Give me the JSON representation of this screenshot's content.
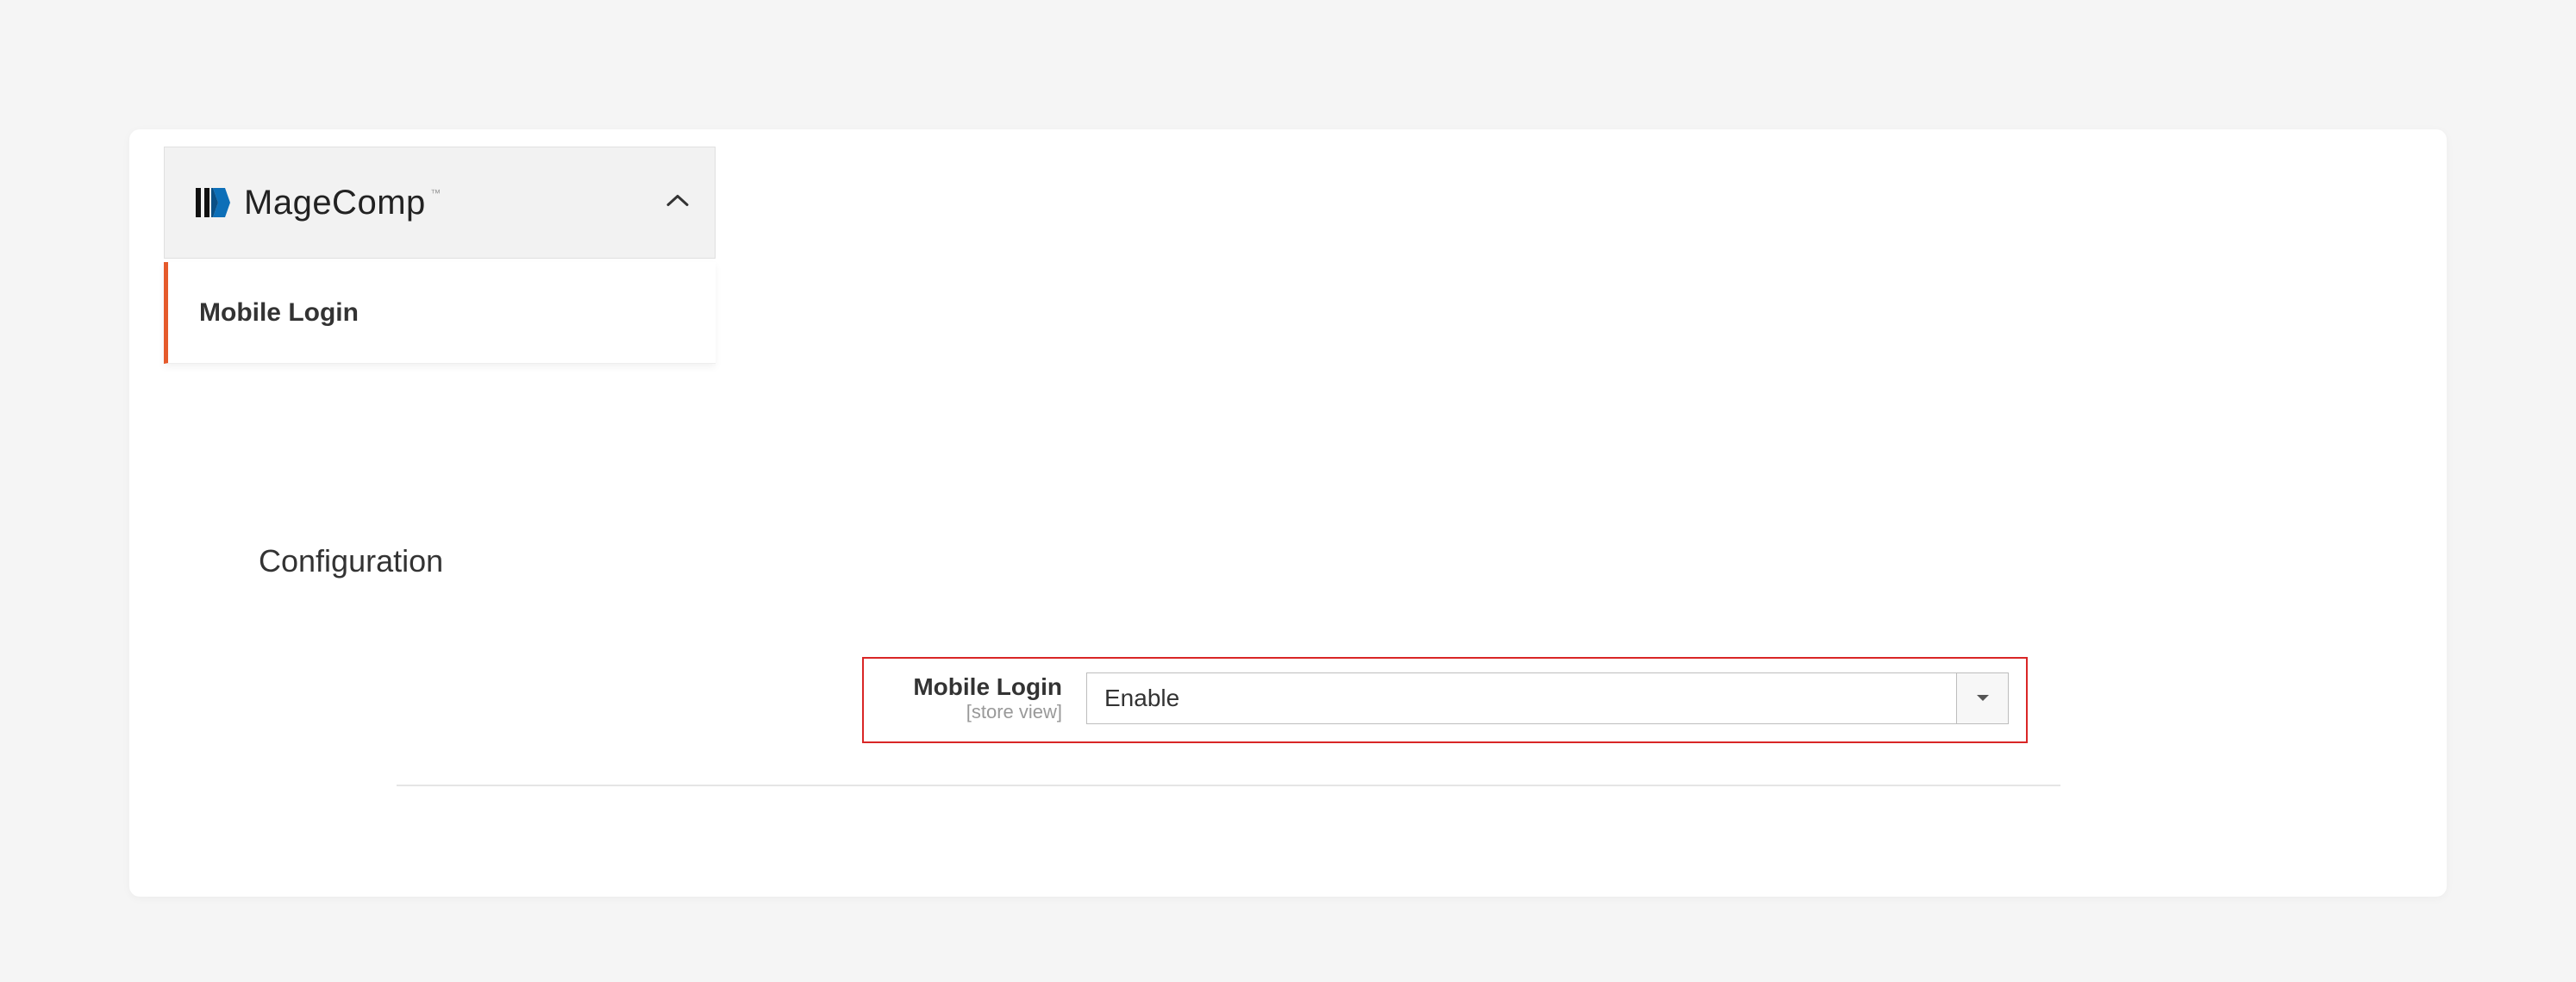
{
  "sidebar": {
    "brand": "MageComp",
    "tm": "™",
    "items": [
      {
        "label": "Mobile Login"
      }
    ]
  },
  "main": {
    "section_title": "Configuration",
    "field": {
      "label": "Mobile Login",
      "scope": "[store view]",
      "value": "Enable"
    }
  }
}
